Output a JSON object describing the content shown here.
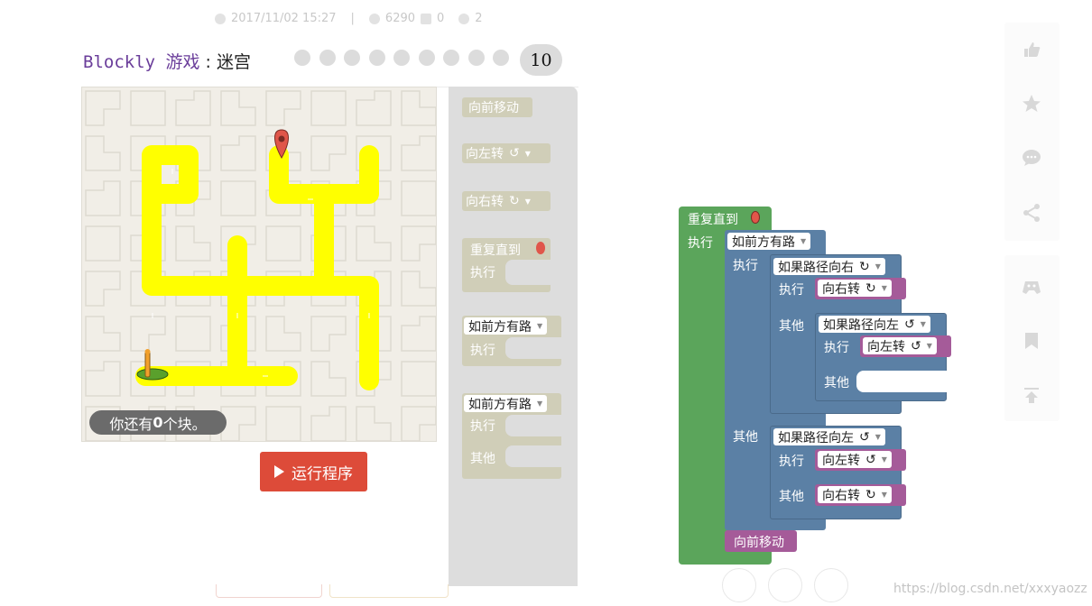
{
  "meta": {
    "date": "2017/11/02 15:27",
    "separator": "|",
    "views": "6290",
    "comments": "0",
    "likes": "2"
  },
  "header": {
    "title_prefix": "Blockly 游戏",
    "title_sep": " : ",
    "title_game": "迷宫",
    "current_level": "10",
    "level_dots": 9
  },
  "maze": {
    "remaining_prefix": "你还有",
    "remaining_count": "0",
    "remaining_suffix": "个块。"
  },
  "run_button": {
    "label": "运行程序"
  },
  "toolbox": {
    "move_forward": "向前移动",
    "turn_left": "向左转",
    "turn_right": "向右转",
    "repeat_until": "重复直到",
    "do": "执行",
    "if_path": "如前方有路",
    "else": "其他",
    "left_glyph": "↺",
    "right_glyph": "↻"
  },
  "program": {
    "repeat_until": "重复直到",
    "do": "执行",
    "else": "其他",
    "if_ahead": "如前方有路",
    "if_right": "如果路径向右",
    "if_left": "如果路径向左",
    "turn_right": "向右转",
    "turn_left": "向左转",
    "move_forward": "向前移动",
    "left_glyph": "↺",
    "right_glyph": "↻"
  },
  "colors": {
    "loop": "#5ba55b",
    "logic": "#5b80a5",
    "action": "#a55b99",
    "run": "#dd4b39",
    "path": "#ffff00"
  },
  "icons": [
    "thumbs-up-icon",
    "star-icon",
    "comment-icon",
    "share-icon",
    "game-icon",
    "bookmark-icon",
    "back-to-top-icon"
  ],
  "watermark": "https://blog.csdn.net/xxxyaozz"
}
